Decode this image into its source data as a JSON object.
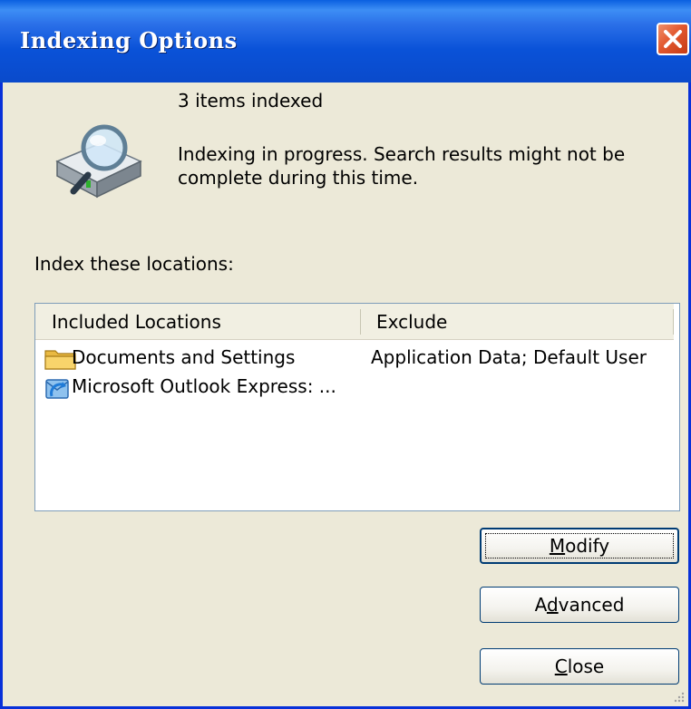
{
  "window": {
    "title": "Indexing Options"
  },
  "status": {
    "items_indexed": "3 items indexed",
    "progress_line1": "Indexing in progress. Search results might not be",
    "progress_line2": "complete during this time."
  },
  "locations": {
    "label": "Index these locations:",
    "columns": {
      "included": "Included Locations",
      "exclude": "Exclude"
    },
    "rows": [
      {
        "included": "Documents and Settings",
        "exclude": "Application Data; Default User",
        "icon": "folder-icon"
      },
      {
        "included": "Microsoft Outlook Express: ...",
        "exclude": "",
        "icon": "outlook-express-icon"
      }
    ]
  },
  "buttons": {
    "modify": {
      "label": "Modify",
      "mnemonic": "M",
      "rest": "odify"
    },
    "advanced": {
      "label": "Advanced",
      "pre": "A",
      "mnemonic": "d",
      "rest": "vanced"
    },
    "close": {
      "label": "Close",
      "mnemonic": "C",
      "rest": "lose"
    }
  }
}
